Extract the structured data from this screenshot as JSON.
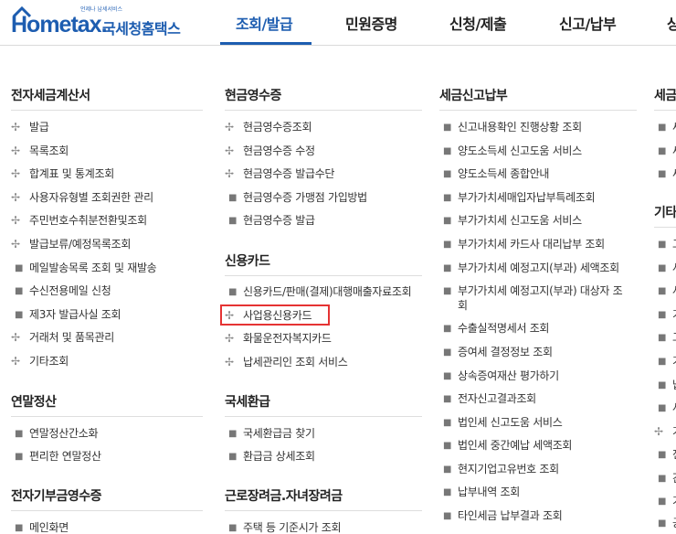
{
  "logo": {
    "tagline": "언제나 납세서비스",
    "brand": "Hometax.",
    "name_kr": "국세청홈택스"
  },
  "gnb": {
    "items": [
      "조회/발급",
      "민원증명",
      "신청/제출",
      "신고/납부",
      "상"
    ]
  },
  "col1": {
    "sections": [
      {
        "title": "전자세금계산서",
        "items": [
          "발급",
          "목록조회",
          "합계표 및 통계조회",
          "사용자유형별 조회권한 관리",
          "주민번호수취분전환및조회",
          "발급보류/예정목록조회",
          "메일발송목록 조회 및 재발송",
          "수신전용메일 신청",
          "제3자 발급사실 조회",
          "거래처 및 품목관리",
          "기타조회"
        ]
      },
      {
        "title": "연말정산",
        "items": [
          "연말정산간소화",
          "편리한 연말정산"
        ]
      },
      {
        "title": "전자기부금영수증",
        "items": [
          "메인화면"
        ]
      }
    ]
  },
  "col2": {
    "sections": [
      {
        "title": "현금영수증",
        "items": [
          "현금영수증조회",
          "현금영수증 수정",
          "현금영수증 발급수단",
          "현금영수증 가맹점 가입방법",
          "현금영수증 발급"
        ]
      },
      {
        "title": "신용카드",
        "items": [
          "신용카드/판매(결제)대행매출자료조회",
          "사업용신용카드",
          "화물운전자복지카드",
          "납세관리인 조회 서비스"
        ]
      },
      {
        "title": "국세환급",
        "items": [
          "국세환급금 찾기",
          "환급금 상세조회"
        ]
      },
      {
        "title": "근로장려금.자녀장려금",
        "items": [
          "주택 등 기준시가 조회"
        ]
      }
    ]
  },
  "col3": {
    "sections": [
      {
        "title": "세금신고납부",
        "items": [
          "신고내용확인 진행상황 조회",
          "양도소득세 신고도움 서비스",
          "양도소득세 종합안내",
          "부가가치세매입자납부특례조회",
          "부가가치세 신고도움 서비스",
          "부가가치세 카드사 대리납부 조회",
          "부가가치세 예정고지(부과) 세액조회",
          "부가가치세 예정고지(부과) 대상자 조",
          "회",
          "수출실적명세서 조회",
          "증여세 결정정보 조회",
          "상속증여재산 평가하기",
          "전자신고결과조회",
          "법인세 신고도움 서비스",
          "법인세 중간예납 세액조회",
          "현지기업고유번호 조회",
          "납부내역 조회",
          "타인세금 납부결과 조회"
        ]
      }
    ]
  },
  "col4": {
    "sections": [
      {
        "title": "세금",
        "items": [
          "세",
          "세",
          "세"
        ]
      },
      {
        "title": "기타",
        "items": [
          "고",
          "사",
          "사",
          "기",
          "고",
          "기",
          "납",
          "사",
          "기",
          "전",
          "간",
          "기",
          "공"
        ]
      }
    ]
  }
}
